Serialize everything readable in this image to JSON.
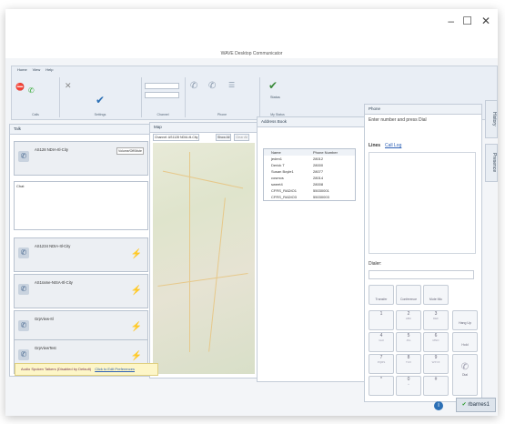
{
  "window": {
    "title": "WAVE Desktop Communicator",
    "min": "–",
    "max": "☐",
    "close": "✕"
  },
  "ribbon": {
    "tabs": [
      "Home",
      "View",
      "Help"
    ],
    "groups": [
      "Calls",
      "Settings",
      "Channel",
      "Phone",
      "My Status"
    ],
    "status_btn": "Status"
  },
  "channels": {
    "header": "Talk",
    "items": [
      {
        "name": "AS128 NDIA-Itl-City",
        "tooltip": "Volume/Off/Mute"
      },
      {
        "name": "AS1234 NDIA-Itl-City"
      },
      {
        "name": "AS1rame-NISA-Itl-City"
      },
      {
        "name": "GrpView-Itl"
      },
      {
        "name": "GrpViewTest"
      }
    ],
    "chat_label": "Chat"
  },
  "map": {
    "header": "Map",
    "channel_label": "Channel: AS1128 NDIA-Itl-City",
    "show_all": "Show All",
    "clear_all": "Clear All"
  },
  "address_book": {
    "header": "Address Book",
    "columns": [
      "Name",
      "Phone Number"
    ],
    "rows": [
      {
        "name": "jeden1",
        "number": "28012"
      },
      {
        "name": "Derick T",
        "number": "28000"
      },
      {
        "name": "Susan Boyle1",
        "number": "28077"
      },
      {
        "name": "cosmos",
        "number": "28014"
      },
      {
        "name": "sweet4",
        "number": "28008"
      },
      {
        "name": "CFRS_RADIO1",
        "number": "55030001"
      },
      {
        "name": "CFRS_RADIO3",
        "number": "55030003"
      }
    ]
  },
  "phone": {
    "header": "Phone",
    "prompt": "Enter number and press Dial",
    "lines_tab": "Lines",
    "calllog_tab": "Call Log",
    "dialer_label": "Dialer:",
    "actions": [
      "Transfer",
      "Conference",
      "Mute Mic"
    ],
    "keys": [
      {
        "d": "1",
        "s": ""
      },
      {
        "d": "2",
        "s": "ABC"
      },
      {
        "d": "3",
        "s": "DEF"
      },
      {
        "d": "4",
        "s": "GHI"
      },
      {
        "d": "5",
        "s": "JKL"
      },
      {
        "d": "6",
        "s": "MNO"
      },
      {
        "d": "7",
        "s": "PQRS"
      },
      {
        "d": "8",
        "s": "TUV"
      },
      {
        "d": "9",
        "s": "WXYZ"
      },
      {
        "d": "*",
        "s": ""
      },
      {
        "d": "0",
        "s": "+"
      },
      {
        "d": "#",
        "s": ""
      }
    ],
    "hang_up": "Hang Up",
    "hold": "Hold",
    "dial": "Dial"
  },
  "side_tabs": {
    "history": "History",
    "presence": "Presence"
  },
  "status_bar": {
    "message": "Audio Spoken Talkers (Disabled by Default)",
    "link": "Click to Edit Preferences"
  },
  "user": {
    "name": "rbarnes1"
  }
}
